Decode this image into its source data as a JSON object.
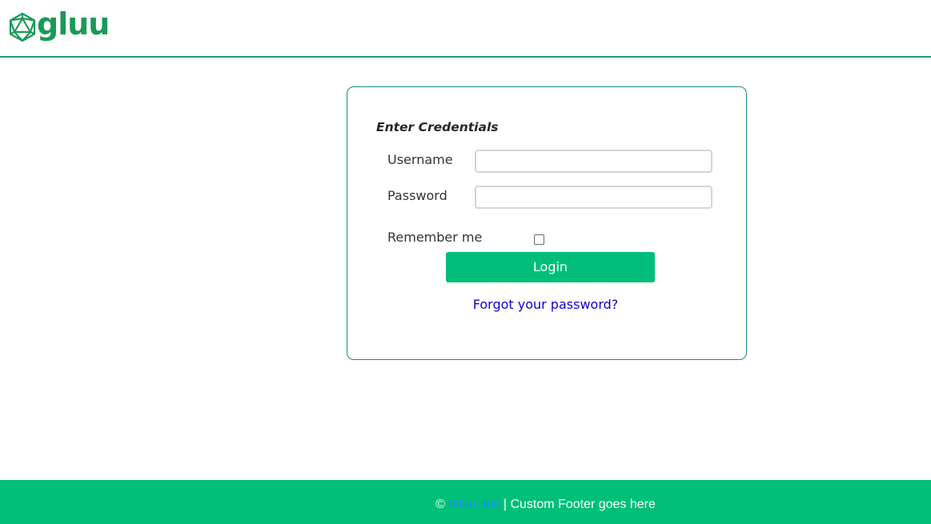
{
  "header": {
    "logo_text": "gluu",
    "logo_icon": "icosahedron-logo-icon",
    "brand_color": "#1a9a58"
  },
  "login_card": {
    "title": "Enter Credentials",
    "username_label": "Username",
    "username_value": "",
    "password_label": "Password",
    "password_value": "",
    "remember_label": "Remember me",
    "remember_checked": false,
    "login_button": "Login",
    "forgot_link": "Forgot your password?",
    "button_color": "#00be79",
    "border_color": "#1a8a86"
  },
  "footer": {
    "copyright": "©",
    "company_link": "Gluu, Inc",
    "text": " | Custom Footer goes here",
    "background_color": "#00bf78"
  }
}
